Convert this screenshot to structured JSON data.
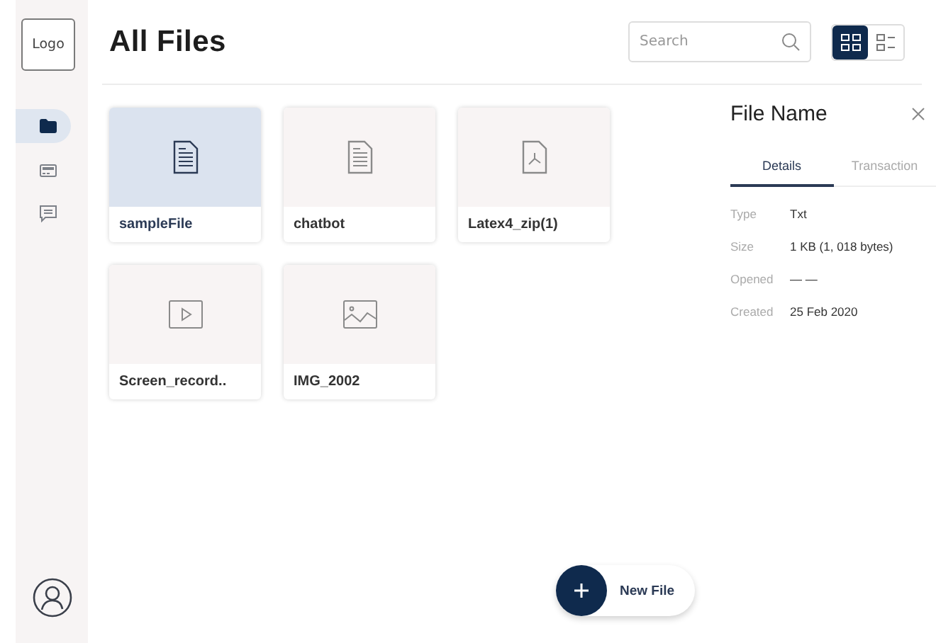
{
  "sidebar": {
    "logo": "Logo",
    "items": [
      {
        "kind": "folder",
        "selected": true
      },
      {
        "kind": "card",
        "selected": false
      },
      {
        "kind": "chat",
        "selected": false
      }
    ]
  },
  "header": {
    "title": "All Files",
    "search": {
      "placeholder": "Search"
    },
    "views": [
      {
        "kind": "grid",
        "selected": true
      },
      {
        "kind": "list",
        "selected": false
      }
    ]
  },
  "files": [
    {
      "name": "sampleFile",
      "kind": "doc",
      "selected": true
    },
    {
      "name": "chatbot",
      "kind": "doc",
      "selected": false
    },
    {
      "name": "Latex4_zip(1)",
      "kind": "pdf",
      "selected": false
    },
    {
      "name": "Screen_record..",
      "kind": "video",
      "selected": false
    },
    {
      "name": "IMG_2002",
      "kind": "image",
      "selected": false
    }
  ],
  "details_panel": {
    "title": "File Name",
    "tabs": [
      {
        "label": "Details",
        "selected": true
      },
      {
        "label": "Transaction",
        "selected": false
      }
    ],
    "rows": [
      {
        "label": "Type",
        "value": "Txt"
      },
      {
        "label": "Size",
        "value": "1 KB (1, 018 bytes)"
      },
      {
        "label": "Opened",
        "value": "— —"
      },
      {
        "label": "Created",
        "value": "25 Feb 2020"
      }
    ]
  },
  "new_file_button": {
    "label": "New File"
  }
}
